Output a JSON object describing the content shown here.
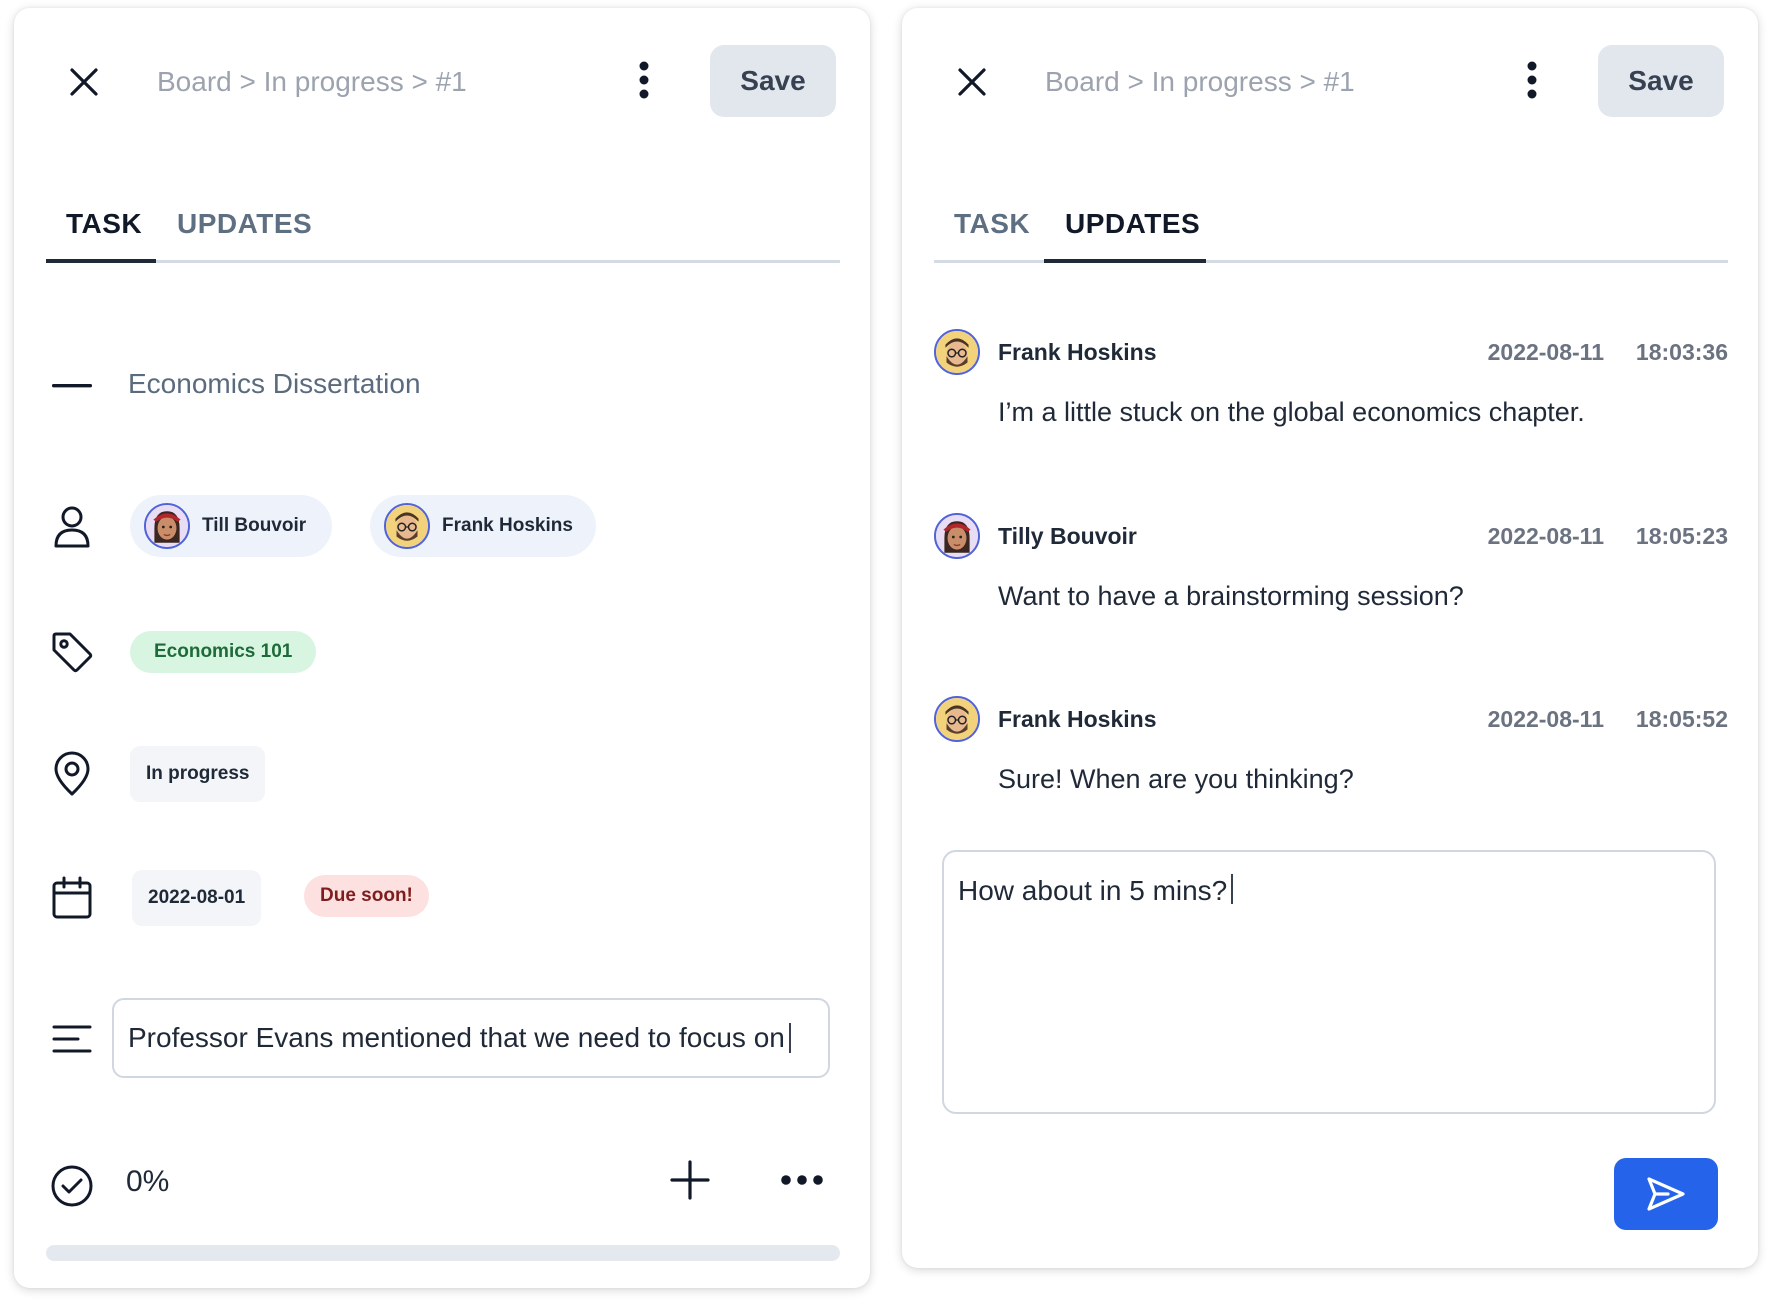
{
  "colors": {
    "accent": "#2563eb",
    "save_bg": "#e2e7ee",
    "tag_bg": "#d8f5e1",
    "tag_text": "#1e6b3a",
    "due_bg": "#fde1e1",
    "due_text": "#7f1d1d",
    "avatar_ring": "#5163d6"
  },
  "header": {
    "breadcrumb": "Board > In progress > #1",
    "save_label": "Save",
    "close_icon": "close-icon",
    "more_icon": "more-vertical-icon"
  },
  "tabs": {
    "task": "TASK",
    "updates": "UPDATES"
  },
  "task": {
    "title": "Economics Dissertation",
    "assignees": [
      {
        "name": "Till Bouvoir",
        "avatar": "tilly-avatar"
      },
      {
        "name": "Frank Hoskins",
        "avatar": "frank-avatar"
      }
    ],
    "tag": "Economics 101",
    "status": "In progress",
    "due_date": "2022-08-01",
    "due_badge": "Due soon!",
    "description": "Professor Evans mentioned that we need to focus on",
    "progress_text": "0%",
    "progress_value": 0
  },
  "updates": {
    "messages": [
      {
        "author": "Frank Hoskins",
        "date": "2022-08-11",
        "time": "18:03:36",
        "text": "I’m a little stuck on the global economics chapter.",
        "avatar": "frank-avatar"
      },
      {
        "author": "Tilly Bouvoir",
        "date": "2022-08-11",
        "time": "18:05:23",
        "text": "Want to have a brainstorming session?",
        "avatar": "tilly-avatar"
      },
      {
        "author": "Frank Hoskins",
        "date": "2022-08-11",
        "time": "18:05:52",
        "text": "Sure! When are you thinking?",
        "avatar": "frank-avatar"
      }
    ],
    "reply_draft": "How about in 5 mins?",
    "send_icon": "send-icon"
  }
}
